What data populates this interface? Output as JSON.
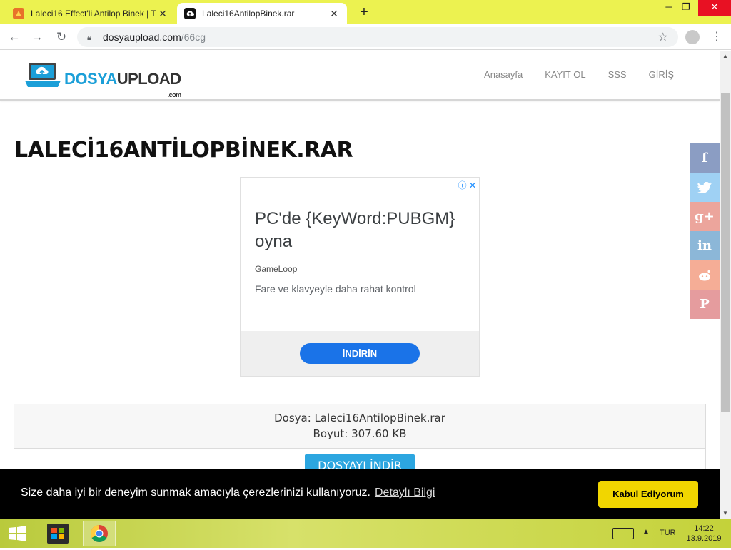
{
  "browser": {
    "tabs": [
      {
        "title": "Laleci16 Effect'li Antilop Binek | T",
        "active": false
      },
      {
        "title": "Laleci16AntilopBinek.rar",
        "active": true
      }
    ],
    "url_host": "dosyaupload.com",
    "url_path": "/66cg"
  },
  "site": {
    "logo_main": "DOSYA",
    "logo_accent": "UPLOAD",
    "logo_suffix": ".com",
    "nav": [
      "Anasayfa",
      "KAYIT OL",
      "SSS",
      "GİRİŞ"
    ]
  },
  "file": {
    "heading": "LALECİ16ANTİLOPBİNEK.RAR",
    "name_line": "Dosya: Laleci16AntilopBinek.rar",
    "size_line": "Boyut: 307.60 KB",
    "download_label": "DOSYAYI İNDİR"
  },
  "ad": {
    "headline": "PC'de {KeyWord:PUBGM} oyna",
    "brand": "GameLoop",
    "description": "Fare ve klavyeyle daha rahat kontrol",
    "cta": "İNDİRİN"
  },
  "share": [
    {
      "icon": "facebook-icon",
      "glyph": "f",
      "color": "#3b5998"
    },
    {
      "icon": "twitter-icon",
      "glyph": "t",
      "color": "#55acee"
    },
    {
      "icon": "google-plus-icon",
      "glyph": "g+",
      "color": "#dd4b39"
    },
    {
      "icon": "linkedin-icon",
      "glyph": "in",
      "color": "#0077b5"
    },
    {
      "icon": "reddit-icon",
      "glyph": "r",
      "color": "#ff4500"
    },
    {
      "icon": "pinterest-icon",
      "glyph": "p",
      "color": "#cb2027"
    }
  ],
  "cookie": {
    "message": "Size daha iyi bir deneyim sunmak amacıyla çerezlerinizi kullanıyoruz.",
    "link": "Detaylı Bilgi",
    "accept": "Kabul Ediyorum"
  },
  "taskbar": {
    "lang": "TUR",
    "time": "14:22",
    "date": "13.9.2019"
  }
}
